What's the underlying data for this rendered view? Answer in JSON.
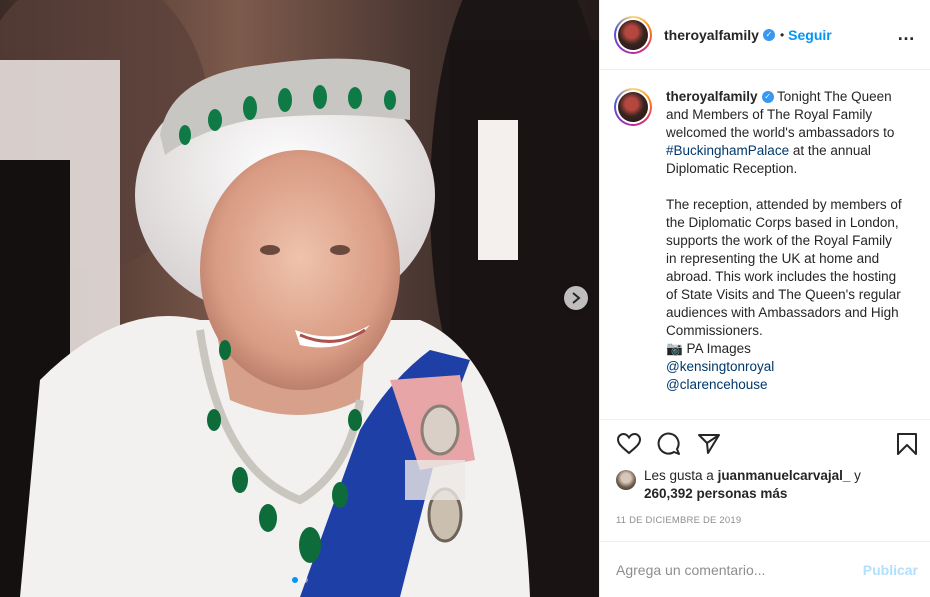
{
  "post": {
    "username": "theroyalfamily",
    "verified_icon": "verified-badge-icon",
    "separator": "•",
    "follow_label": "Seguir",
    "more_icon": "…"
  },
  "caption": {
    "username": "theroyalfamily",
    "text_part1": " Tonight The Queen and Members of The Royal Family welcomed the world's ambassadors to ",
    "hashtag": "#BuckinghamPalace",
    "text_part2": " at the annual Diplomatic Reception.\n\nThe reception, attended by members of the Diplomatic Corps based in London, supports the work of the Royal Family in representing the UK at home and abroad. This work includes the hosting of State Visits and The Queen's regular audiences with Ambassadors and High Commissioners.\n📷 PA Images\n",
    "mention1": "@kensingtonroyal",
    "mention2": "@clarencehouse"
  },
  "likes": {
    "prefix": "Les gusta a ",
    "liker": "juanmanuelcarvajal_",
    "middle": " y ",
    "count_text": "260,392 personas más"
  },
  "date": "11 DE DICIEMBRE DE 2019",
  "comment": {
    "placeholder": "Agrega un comentario...",
    "publish_label": "Publicar"
  },
  "colors": {
    "accent": "#0095f6",
    "link": "#00376b",
    "muted": "#8e8e8e"
  }
}
